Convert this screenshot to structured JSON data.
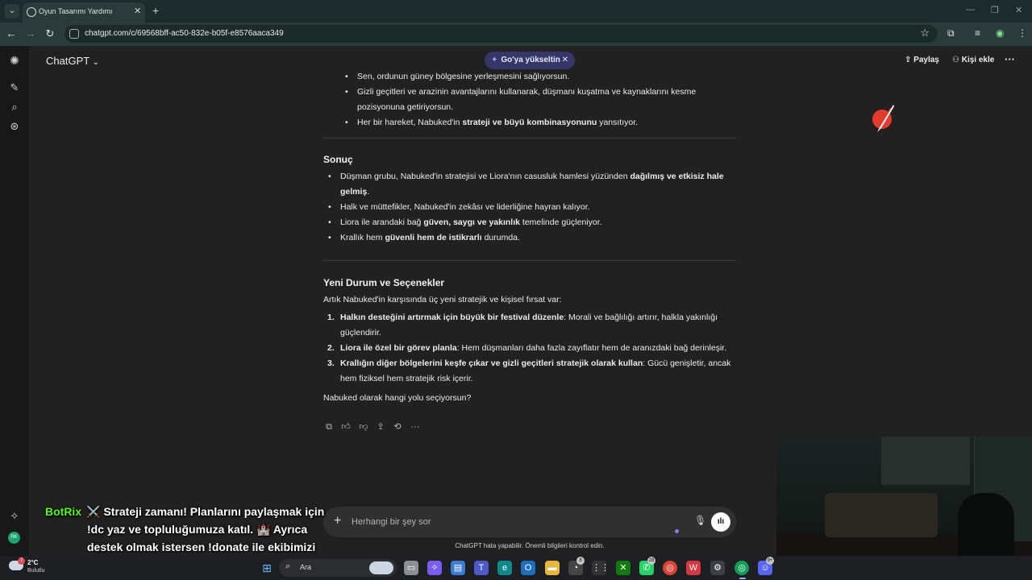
{
  "browser": {
    "tab_title": "Oyun Tasarımı Yardımı",
    "url": "chatgpt.com/c/69568bff-ac50-832e-b05f-e8576aaca349"
  },
  "header": {
    "app_name": "ChatGPT",
    "upgrade_label": "Go'ya yükseltin",
    "share_label": "Paylaş",
    "add_person_label": "Kişi ekle"
  },
  "chat": {
    "top_bullets": [
      {
        "text": "Sen, ordunun güney bölgesine yerleşmesini sağlıyorsun."
      },
      {
        "text": "Gizli geçitleri ve arazinin avantajlarını kullanarak, düşmanı kuşatma ve kaynaklarını kesme pozisyonuna getiriyorsun."
      },
      {
        "pre": "Her bir hareket, Nabuked'in ",
        "bold": "strateji ve büyü kombinasyonunu",
        "post": " yansıtıyor."
      }
    ],
    "section1_title": "Sonuç",
    "section1_bullets": [
      {
        "pre": "Düşman grubu, Nabuked'in stratejisi ve Liora'nın casusluk hamlesi yüzünden ",
        "bold": "dağılmış ve etkisiz hale gelmiş",
        "post": "."
      },
      {
        "pre": "Halk ve müttefikler, Nabuked'in zekâsı ve liderliğine hayran kalıyor.",
        "bold": "",
        "post": ""
      },
      {
        "pre": "Liora ile arandaki bağ ",
        "bold": "güven, saygı ve yakınlık",
        "post": " temelinde güçleniyor."
      },
      {
        "pre": "Krallık hem ",
        "bold": "güvenli hem de istikrarlı",
        "post": " durumda."
      }
    ],
    "section2_title": "Yeni Durum ve Seçenekler",
    "section2_intro": "Artık Nabuked'in karşısında üç yeni stratejik ve kişisel fırsat var:",
    "options": [
      {
        "num": "1.",
        "bold": "Halkın desteğini artırmak için büyük bir festival düzenle",
        "post": ": Morali ve bağlılığı artırır, halkla yakınlığı güçlendirir."
      },
      {
        "num": "2.",
        "bold": "Liora ile özel bir görev planla",
        "post": ": Hem düşmanları daha fazla zayıflatır hem de aranızdaki bağ derinleşir."
      },
      {
        "num": "3.",
        "bold": "Krallığın diğer bölgelerini keşfe çıkar ve gizli geçitleri stratejik olarak kullan",
        "post": ": Gücü genişletir, ancak hem fiziksel hem stratejik risk içerir."
      }
    ],
    "question": "Nabuked olarak hangi yolu seçiyorsun?"
  },
  "composer": {
    "placeholder": "Herhangi bir şey sor",
    "disclaimer": "ChatGPT hata yapabilir. Önemli bilgileri kontrol edin."
  },
  "overlay": {
    "bot_name": "BotRix",
    "message": "⚔️ Strateji zamanı! Planlarını paylaşmak için !dc yaz ve topluluğumuza katıl. 🏰 Ayrıca destek olmak istersen !donate ile ekibimizi güçlendirebilirsin! 💎"
  },
  "taskbar": {
    "temperature": "2°C",
    "condition": "Bulutlu",
    "search_label": "Ara",
    "badge_1": "8",
    "badge_2": "28",
    "badge_3": "9+",
    "weather_badge": "7"
  },
  "sidebar": {
    "avatar_initials": "RK"
  },
  "colors": {
    "background": "#212121",
    "upgrade_pill": "#373669",
    "botrix_name": "#53fc18",
    "accent_dot": "#8b7cf6"
  }
}
